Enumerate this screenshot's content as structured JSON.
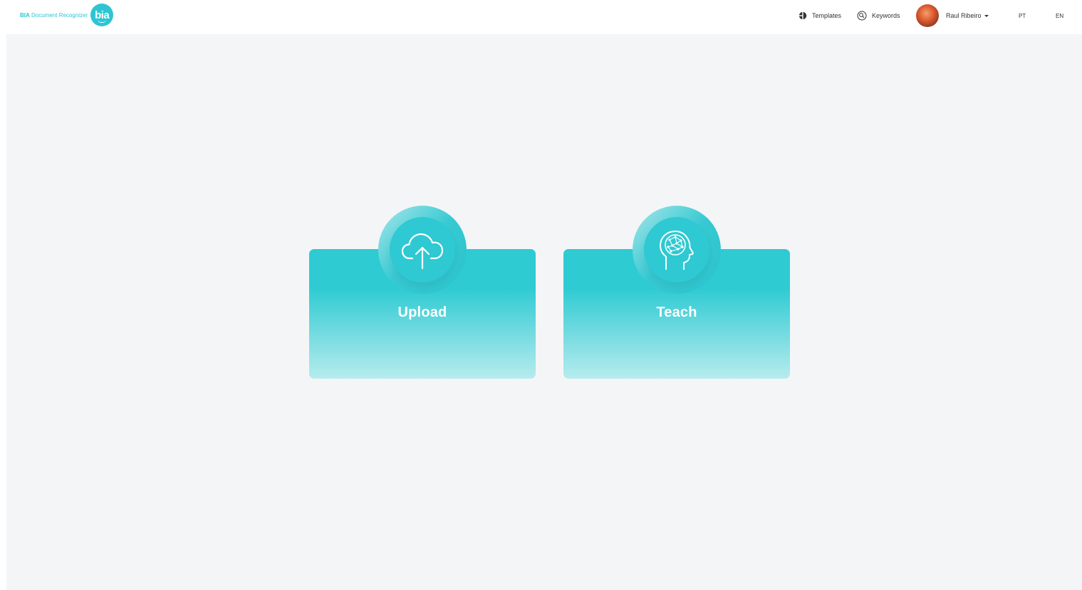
{
  "brand": {
    "name_bold": "BIA",
    "name_rest": " Document Recognizer",
    "logo_text": "bia",
    "accent_color": "#2ec5d3"
  },
  "nav": {
    "templates_label": "Templates",
    "keywords_label": "Keywords",
    "user_name": "Raul Ribeiro",
    "lang_pt": "PT",
    "lang_en": "EN"
  },
  "cards": [
    {
      "label": "Upload",
      "icon": "cloud-upload-icon"
    },
    {
      "label": "Teach",
      "icon": "brain-head-icon"
    }
  ]
}
